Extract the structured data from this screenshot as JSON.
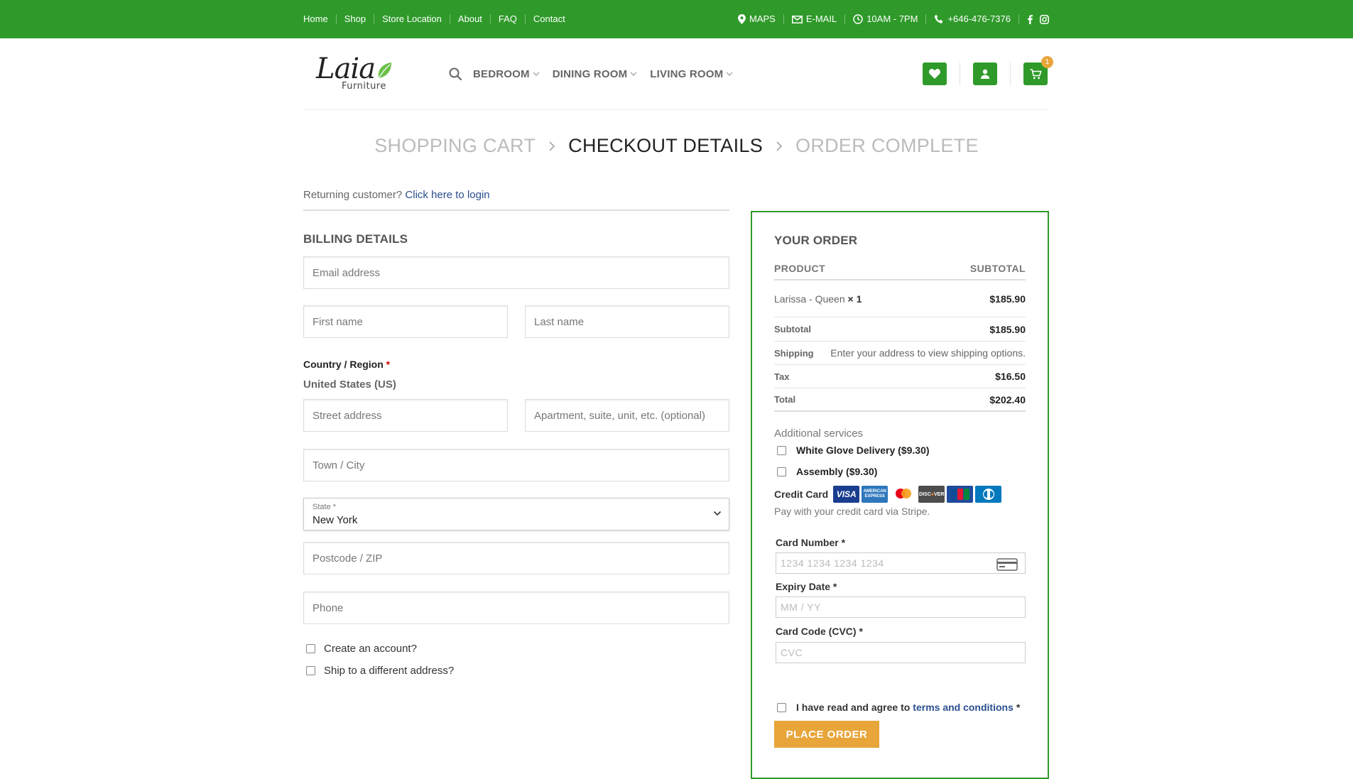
{
  "topbar": {
    "nav": [
      "Home",
      "Shop",
      "Store Location",
      "About",
      "FAQ",
      "Contact"
    ],
    "maps": "MAPS",
    "email": "E-MAIL",
    "hours": "10AM - 7PM",
    "phone": "+646-476-7376"
  },
  "header": {
    "logo_script": "Laia",
    "logo_sub": "Furniture",
    "menu": [
      "BEDROOM",
      "DINING ROOM",
      "LIVING ROOM"
    ],
    "cart_count": "1"
  },
  "steps": {
    "cart": "SHOPPING CART",
    "checkout": "CHECKOUT DETAILS",
    "complete": "ORDER COMPLETE"
  },
  "billing": {
    "returning_text": "Returning customer?",
    "login_link": "Click here to login",
    "title": "BILLING DETAILS",
    "email_placeholder": "Email address",
    "first_name_placeholder": "First name",
    "last_name_placeholder": "Last name",
    "country_label": "Country / Region",
    "country_required": "*",
    "country_value": "United States (US)",
    "street_placeholder": "Street address",
    "apartment_placeholder": "Apartment, suite, unit, etc. (optional)",
    "city_placeholder": "Town / City",
    "state_label": "State *",
    "state_value": "New York",
    "zip_placeholder": "Postcode / ZIP",
    "phone_placeholder": "Phone",
    "create_account": "Create an account?",
    "ship_different": "Ship to a different address?"
  },
  "order": {
    "title": "YOUR ORDER",
    "col_product": "PRODUCT",
    "col_subtotal": "SUBTOTAL",
    "product_name": "Larissa - Queen",
    "product_qty": "× 1",
    "product_price": "$185.90",
    "subtotal_label": "Subtotal",
    "subtotal_value": "$185.90",
    "shipping_label": "Shipping",
    "shipping_value": "Enter your address to view shipping options.",
    "tax_label": "Tax",
    "tax_value": "$16.50",
    "total_label": "Total",
    "total_value": "$202.40",
    "additional_title": "Additional services",
    "white_glove": "White Glove Delivery ($9.30)",
    "assembly": "Assembly ($9.30)",
    "credit_card_label": "Credit Card",
    "pay_with": "Pay with your credit card via Stripe.",
    "card_number_label": "Card Number *",
    "card_number_placeholder": "1234 1234 1234 1234",
    "expiry_label": "Expiry Date *",
    "expiry_placeholder": "MM / YY",
    "cvc_label": "Card Code (CVC) *",
    "cvc_placeholder": "CVC",
    "terms_text": "I have read and agree to",
    "terms_link": "terms and conditions",
    "terms_required": "*",
    "place_order": "PLACE ORDER"
  },
  "colors": {
    "brand_green": "#2f9a2a",
    "accent_orange": "#e8a53a",
    "link_blue": "#2a4f8f"
  }
}
